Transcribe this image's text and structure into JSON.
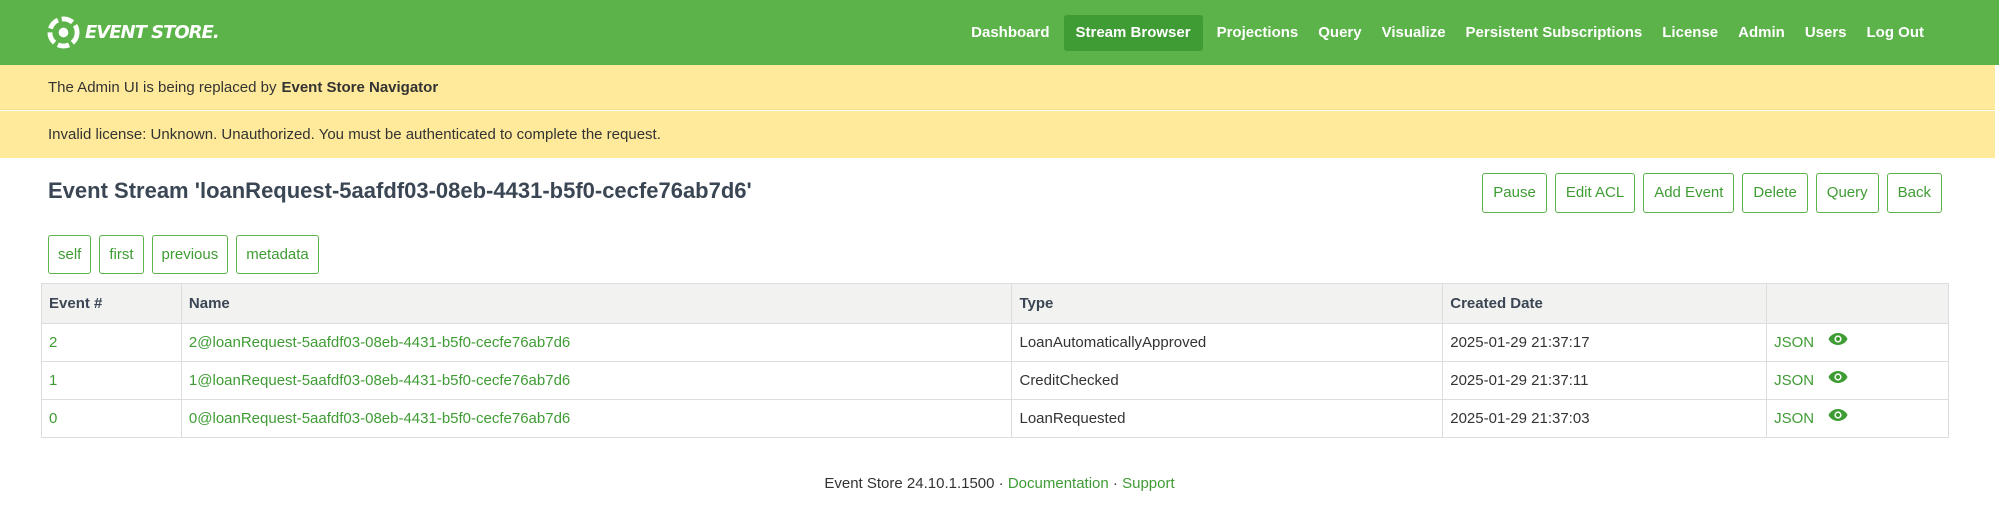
{
  "header": {
    "logo_text": "EVENT STORE.",
    "nav": [
      {
        "label": "Dashboard",
        "active": false
      },
      {
        "label": "Stream Browser",
        "active": true
      },
      {
        "label": "Projections",
        "active": false
      },
      {
        "label": "Query",
        "active": false
      },
      {
        "label": "Visualize",
        "active": false
      },
      {
        "label": "Persistent Subscriptions",
        "active": false
      },
      {
        "label": "License",
        "active": false
      },
      {
        "label": "Admin",
        "active": false
      },
      {
        "label": "Users",
        "active": false
      },
      {
        "label": "Log Out",
        "active": false
      }
    ]
  },
  "banners": {
    "replaced_text": "The Admin UI is being replaced by",
    "replaced_link": "Event Store Navigator",
    "license_text": "Invalid license: Unknown. Unauthorized. You must be authenticated to complete the request."
  },
  "stream": {
    "title": "Event Stream 'loanRequest-5aafdf03-08eb-4431-b5f0-cecfe76ab7d6'",
    "actions": {
      "pause": "Pause",
      "edit_acl": "Edit ACL",
      "add_event": "Add Event",
      "delete": "Delete",
      "query": "Query",
      "back": "Back"
    },
    "links": {
      "self": "self",
      "first": "first",
      "previous": "previous",
      "metadata": "metadata"
    }
  },
  "table": {
    "headers": {
      "event_num": "Event #",
      "name": "Name",
      "type": "Type",
      "created": "Created Date",
      "extra": ""
    },
    "rows": [
      {
        "num": "2",
        "name": "2@loanRequest-5aafdf03-08eb-4431-b5f0-cecfe76ab7d6",
        "type": "LoanAutomaticallyApproved",
        "created": "2025-01-29 21:37:17",
        "json": "JSON"
      },
      {
        "num": "1",
        "name": "1@loanRequest-5aafdf03-08eb-4431-b5f0-cecfe76ab7d6",
        "type": "CreditChecked",
        "created": "2025-01-29 21:37:11",
        "json": "JSON"
      },
      {
        "num": "0",
        "name": "0@loanRequest-5aafdf03-08eb-4431-b5f0-cecfe76ab7d6",
        "type": "LoanRequested",
        "created": "2025-01-29 21:37:03",
        "json": "JSON"
      }
    ],
    "row_icon": "eye-icon"
  },
  "footer": {
    "version": "Event Store 24.10.1.1500",
    "sep": "·",
    "documentation": "Documentation",
    "support": "Support"
  },
  "colors": {
    "brand_green": "#5cb349",
    "active_green": "#3f9c34",
    "banner_yellow": "#feea9a"
  }
}
